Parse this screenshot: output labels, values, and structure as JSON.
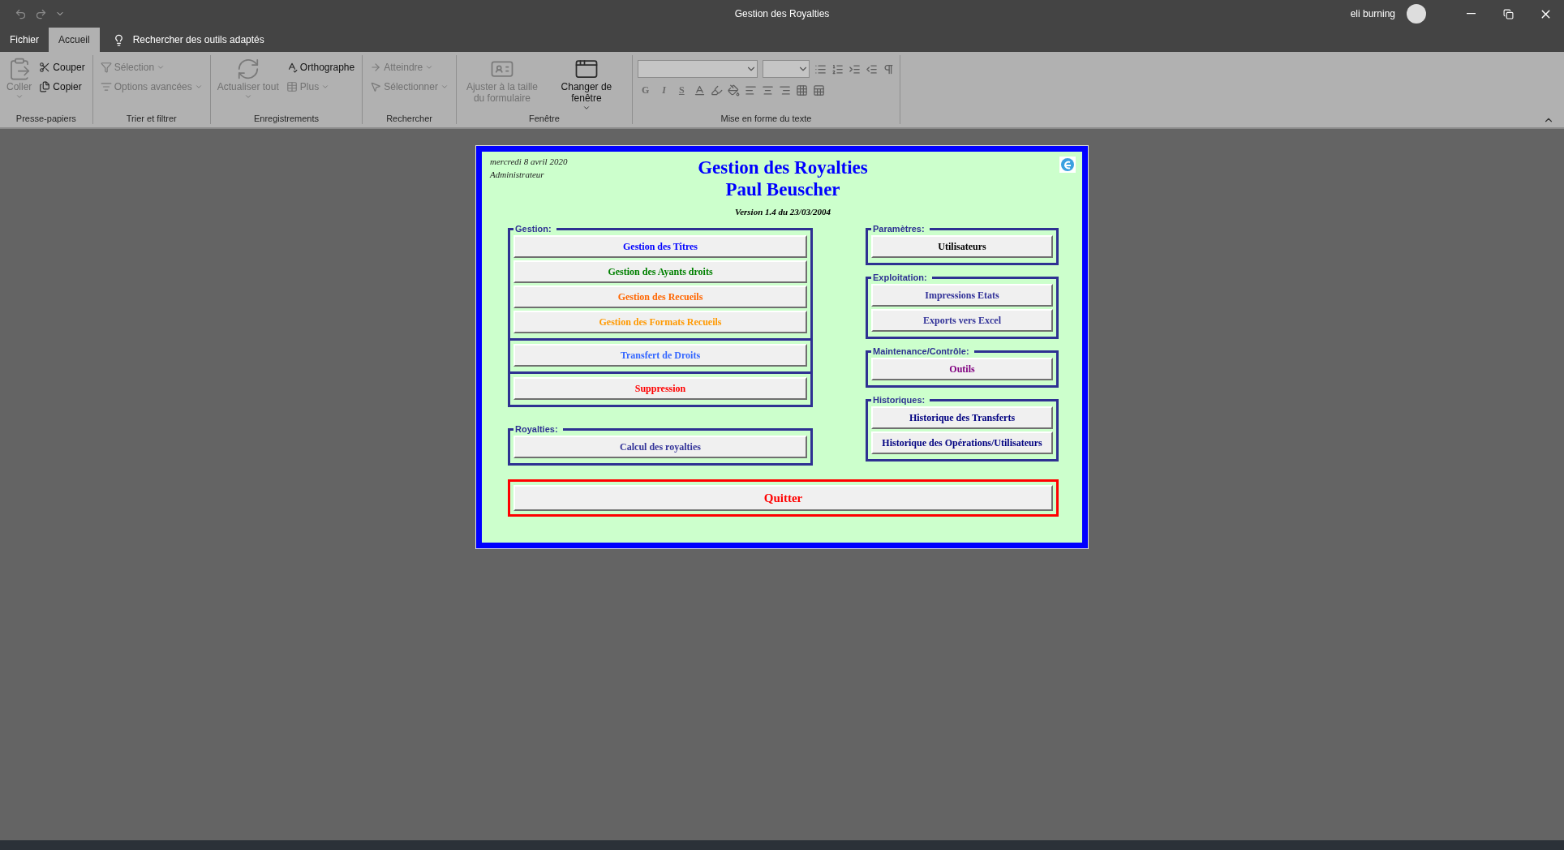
{
  "window": {
    "title": "Gestion des Royalties",
    "user": "eli burning"
  },
  "ribbon_tabs": [
    {
      "label": "Fichier",
      "selected": false
    },
    {
      "label": "Accueil",
      "selected": true
    }
  ],
  "tell_me": {
    "label": "Rechercher des outils adaptés"
  },
  "ribbon_groups": [
    {
      "title": "Presse-papiers",
      "items": [
        {
          "label": "Coller",
          "kind": "large",
          "disabled": true,
          "dropdown": true
        },
        {
          "label": "Couper",
          "kind": "small",
          "disabled": false,
          "dropdown": false
        },
        {
          "label": "Copier",
          "kind": "small",
          "disabled": false,
          "dropdown": false
        }
      ]
    },
    {
      "title": "Trier et filtrer",
      "items": [
        {
          "label": "Sélection",
          "kind": "small",
          "disabled": true,
          "dropdown": true
        },
        {
          "label": "Options avancées",
          "kind": "small",
          "disabled": true,
          "dropdown": true
        }
      ]
    },
    {
      "title": "Enregistrements",
      "items": [
        {
          "label": "Actualiser tout",
          "kind": "large",
          "disabled": true,
          "dropdown": true
        },
        {
          "label": "Orthographe",
          "kind": "small",
          "disabled": false,
          "dropdown": false
        },
        {
          "label": "Plus",
          "kind": "small",
          "disabled": true,
          "dropdown": true
        }
      ]
    },
    {
      "title": "Rechercher",
      "items": [
        {
          "label": "Atteindre",
          "kind": "small",
          "disabled": true,
          "dropdown": true
        },
        {
          "label": "Sélectionner",
          "kind": "small",
          "disabled": true,
          "dropdown": true
        }
      ]
    },
    {
      "title": "Fenêtre",
      "items": [
        {
          "label": "Ajuster à la taille du formulaire",
          "kind": "large",
          "disabled": true,
          "dropdown": false
        },
        {
          "label": "Changer de fenêtre",
          "kind": "large",
          "disabled": false,
          "dropdown": true
        }
      ]
    }
  ],
  "format_group": {
    "title": "Mise en forme du texte",
    "style_buttons": [
      {
        "label": "G",
        "disabled": true
      },
      {
        "label": "I",
        "disabled": true
      },
      {
        "label": "S",
        "disabled": true
      }
    ]
  },
  "form": {
    "date": "mercredi 8 avril 2020",
    "role": "Administrateur",
    "title": "Gestion des Royalties",
    "subtitle": "Paul Beuscher",
    "version": "Version 1.4 du 23/03/2004",
    "left_groups": [
      {
        "title": "Gestion:",
        "sections": [
          [
            {
              "label": "Gestion des Titres",
              "color": "#0000ff"
            },
            {
              "label": "Gestion des Ayants droits",
              "color": "#008000"
            },
            {
              "label": "Gestion des Recueils",
              "color": "#ff6600"
            },
            {
              "label": "Gestion des Formats Recueils",
              "color": "#ff9900"
            }
          ],
          [
            {
              "label": "Transfert de Droits",
              "color": "#3366ff"
            }
          ],
          [
            {
              "label": "Suppression",
              "color": "#ff0000"
            }
          ]
        ]
      },
      {
        "title": "Royalties:",
        "sections": [
          [
            {
              "label": "Calcul des royalties",
              "color": "#333399"
            }
          ]
        ]
      }
    ],
    "right_groups": [
      {
        "title": "Paramètres:",
        "sections": [
          [
            {
              "label": "Utilisateurs",
              "color": "#000000"
            }
          ]
        ]
      },
      {
        "title": "Exploitation:",
        "sections": [
          [
            {
              "label": "Impressions Etats",
              "color": "#333399"
            },
            {
              "label": "Exports vers Excel",
              "color": "#333399"
            }
          ]
        ]
      },
      {
        "title": "Maintenance/Contrôle:",
        "sections": [
          [
            {
              "label": "Outils",
              "color": "#800080"
            }
          ]
        ]
      },
      {
        "title": "Historiques:",
        "sections": [
          [
            {
              "label": "Historique des  Transferts",
              "color": "#000080"
            },
            {
              "label": "Historique des  Opérations/Utilisateurs",
              "color": "#000080"
            }
          ]
        ]
      }
    ],
    "quit_button": {
      "label": "Quitter",
      "color": "#ff0000"
    }
  }
}
